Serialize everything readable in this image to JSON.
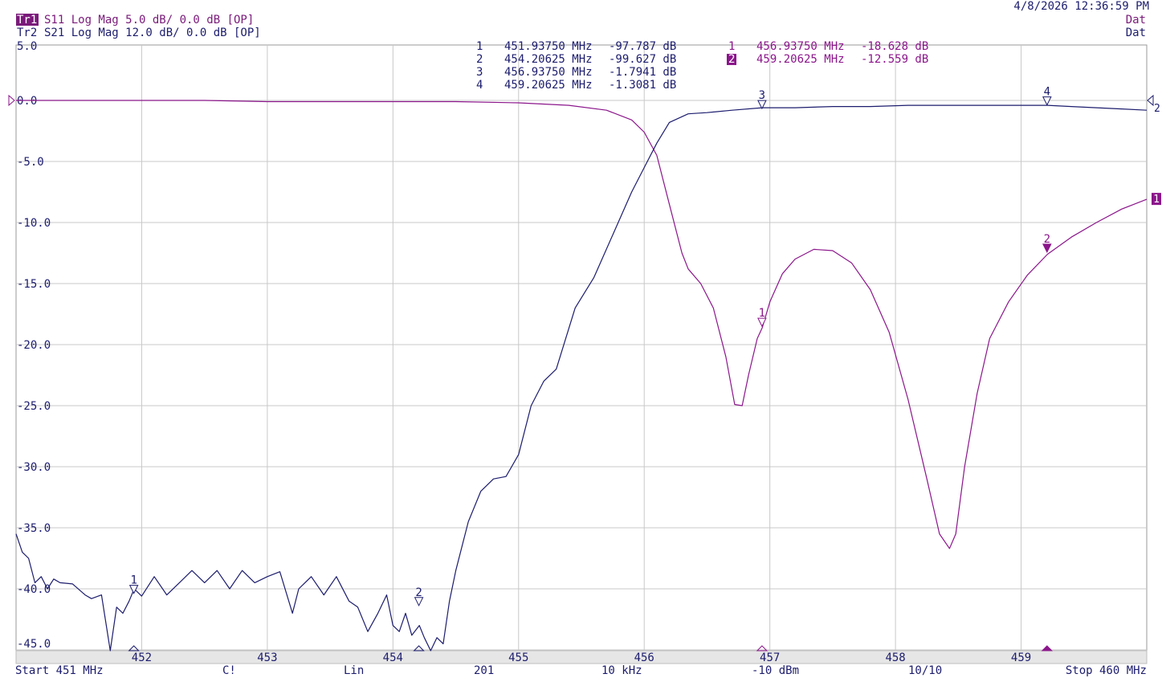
{
  "header": {
    "datetime": "4/8/2026 12:36:59 PM",
    "trace1": {
      "id": "Tr1",
      "desc": "S11 Log Mag 5.0 dB/ 0.0 dB [OP]",
      "dat": "Dat"
    },
    "trace2": {
      "id": "Tr2",
      "desc": "S21 Log Mag 12.0 dB/ 0.0 dB [OP]",
      "dat": "Dat"
    }
  },
  "colors": {
    "s11": "#8b168b",
    "s21": "#1c1c6e",
    "grid": "#c8c8c8",
    "text_blue": "#1c1c6e",
    "text_purple": "#7a1a7a"
  },
  "marker_table_s21": [
    {
      "n": "1",
      "freq": "451.93750 MHz",
      "val": "-97.787 dB"
    },
    {
      "n": "2",
      "freq": "454.20625 MHz",
      "val": "-99.627 dB"
    },
    {
      "n": "3",
      "freq": "456.93750 MHz",
      "val": "-1.7941 dB"
    },
    {
      "n": "4",
      "freq": "459.20625 MHz",
      "val": "-1.3081 dB"
    }
  ],
  "marker_table_s11": [
    {
      "n": "1",
      "freq": "456.93750 MHz",
      "val": "-18.628 dB"
    },
    {
      "n": "2",
      "freq": "459.20625 MHz",
      "val": "-12.559 dB"
    }
  ],
  "footer": {
    "start": "Start 451 MHz",
    "c": "C!",
    "lin": "Lin",
    "points": "201",
    "ifbw": "10 kHz",
    "power": "-10 dBm",
    "avg": "10/10",
    "stop": "Stop 460 MHz"
  },
  "chart_data": {
    "type": "line",
    "xlim": [
      451,
      460
    ],
    "ylim": [
      -46,
      5
    ],
    "x_ticks": [
      "452",
      "453",
      "454",
      "455",
      "456",
      "457",
      "458",
      "459"
    ],
    "y_ticks": [
      "5.0",
      "0.0",
      "-5.0",
      "-10.0",
      "-15.0",
      "-20.0",
      "-25.0",
      "-30.0",
      "-35.0",
      "-40.0",
      "-45.0"
    ],
    "grid": true,
    "series": [
      {
        "name": "S11",
        "x": [
          451.0,
          451.5,
          452.0,
          452.5,
          453.0,
          453.5,
          454.0,
          454.5,
          455.0,
          455.4,
          455.7,
          455.9,
          456.0,
          456.1,
          456.2,
          456.3,
          456.35,
          456.45,
          456.55,
          456.65,
          456.72,
          456.78,
          456.83,
          456.9,
          456.94,
          457.0,
          457.1,
          457.2,
          457.35,
          457.5,
          457.65,
          457.8,
          457.95,
          458.1,
          458.25,
          458.35,
          458.43,
          458.48,
          458.55,
          458.65,
          458.75,
          458.9,
          459.05,
          459.21,
          459.4,
          459.6,
          459.8,
          460.0
        ],
        "y": [
          0.0,
          0.0,
          0.0,
          0.0,
          -0.1,
          -0.1,
          -0.1,
          -0.1,
          -0.2,
          -0.4,
          -0.8,
          -1.6,
          -2.6,
          -4.5,
          -8.5,
          -12.5,
          -13.8,
          -15.0,
          -17.0,
          -21.0,
          -24.9,
          -25.0,
          -22.5,
          -19.5,
          -18.6,
          -16.5,
          -14.2,
          -13.0,
          -12.2,
          -12.3,
          -13.3,
          -15.5,
          -19.0,
          -24.5,
          -31.0,
          -35.5,
          -36.7,
          -35.5,
          -30.0,
          -24.0,
          -19.5,
          -16.5,
          -14.3,
          -12.6,
          -11.2,
          -10.0,
          -8.9,
          -8.1
        ]
      },
      {
        "name": "S21",
        "x": [
          451.0,
          451.05,
          451.1,
          451.15,
          451.2,
          451.25,
          451.3,
          451.35,
          451.45,
          451.55,
          451.6,
          451.68,
          451.75,
          451.8,
          451.85,
          451.9,
          451.94,
          452.0,
          452.1,
          452.2,
          452.3,
          452.4,
          452.5,
          452.6,
          452.7,
          452.8,
          452.9,
          453.0,
          453.1,
          453.2,
          453.25,
          453.35,
          453.45,
          453.55,
          453.65,
          453.72,
          453.8,
          453.88,
          453.95,
          454.0,
          454.05,
          454.1,
          454.15,
          454.21,
          454.25,
          454.3,
          454.35,
          454.4,
          454.45,
          454.5,
          454.6,
          454.7,
          454.8,
          454.9,
          455.0,
          455.1,
          455.2,
          455.3,
          455.45,
          455.6,
          455.75,
          455.9,
          456.0,
          456.1,
          456.2,
          456.35,
          456.5,
          456.7,
          456.94,
          457.2,
          457.5,
          457.8,
          458.1,
          458.4,
          458.7,
          459.0,
          459.21,
          459.4,
          459.6,
          459.8,
          460.0
        ],
        "y": [
          -35.5,
          -37.0,
          -37.5,
          -39.5,
          -39.0,
          -40.0,
          -39.2,
          -39.5,
          -39.6,
          -40.5,
          -40.8,
          -40.5,
          -46.0,
          -41.5,
          -42.0,
          -41.0,
          -40.0,
          -40.6,
          -39.0,
          -40.5,
          -39.5,
          -38.5,
          -39.5,
          -38.5,
          -40.0,
          -38.5,
          -39.5,
          -39.0,
          -38.6,
          -42.0,
          -40.0,
          -39.0,
          -40.5,
          -39.0,
          -41.0,
          -41.5,
          -43.5,
          -42.0,
          -40.5,
          -43.0,
          -43.5,
          -42.0,
          -43.8,
          -43.0,
          -44.0,
          -46.0,
          -44.0,
          -44.5,
          -41.0,
          -38.5,
          -34.5,
          -32.0,
          -31.0,
          -30.8,
          -29.0,
          -25.0,
          -23.0,
          -22.0,
          -17.0,
          -14.5,
          -11.0,
          -7.5,
          -5.5,
          -3.5,
          -1.8,
          -1.1,
          -1.0,
          -0.8,
          -0.6,
          -0.6,
          -0.5,
          -0.5,
          -0.4,
          -0.4,
          -0.4,
          -0.4,
          -0.4,
          -0.5,
          -0.6,
          -0.7,
          -0.8
        ]
      }
    ],
    "markers_s21": [
      {
        "n": "1",
        "x": 451.9375,
        "y": -40.5
      },
      {
        "n": "2",
        "x": 454.20625,
        "y": -41.5
      },
      {
        "n": "3",
        "x": 456.9375,
        "y": -0.8
      },
      {
        "n": "4",
        "x": 459.20625,
        "y": -0.5
      }
    ],
    "markers_s11": [
      {
        "n": "1",
        "x": 456.9375,
        "y": -18.628,
        "active": false
      },
      {
        "n": "2",
        "x": 459.20625,
        "y": -12.559,
        "active": true
      }
    ],
    "bottom_markers": [
      {
        "x": 451.9375,
        "trace": "s21",
        "filled": false
      },
      {
        "x": 454.20625,
        "trace": "s21",
        "filled": false
      },
      {
        "x": 456.9375,
        "trace": "s11",
        "filled": false
      },
      {
        "x": 459.20625,
        "trace": "s11",
        "filled": true
      }
    ],
    "right_ref_labels": [
      {
        "label": "2",
        "trace": "s21",
        "y": 0.0,
        "style": "open"
      },
      {
        "label": "1",
        "trace": "s11",
        "y": -8.1,
        "style": "filled"
      }
    ],
    "left_ref": {
      "trace": "s11",
      "y": 0.0
    }
  }
}
